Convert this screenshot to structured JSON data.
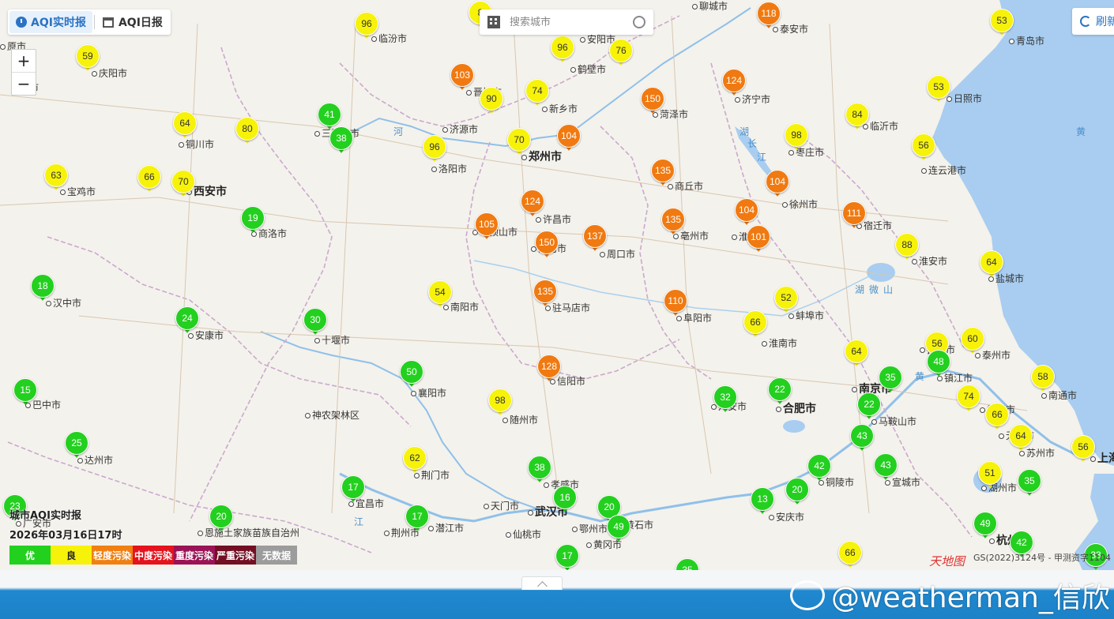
{
  "tabs": [
    {
      "label": "AQI实时报",
      "active": true
    },
    {
      "label": "AQI日报",
      "active": false
    }
  ],
  "zoom": {
    "in": "+",
    "out": "−"
  },
  "search": {
    "placeholder": "搜索城市"
  },
  "refresh_label": "刷新",
  "legend": {
    "title": "城市AQI实时报",
    "time": "2026年03月16日17时",
    "levels": [
      {
        "label": "优",
        "color": "#22d11e"
      },
      {
        "label": "良",
        "color": "#f7f20a"
      },
      {
        "label": "轻度污染",
        "color": "#f08012"
      },
      {
        "label": "中度污染",
        "color": "#e4131d"
      },
      {
        "label": "重度污染",
        "color": "#9b1356"
      },
      {
        "label": "严重污染",
        "color": "#730f24"
      },
      {
        "label": "无数据",
        "color": "#9c9c9c"
      }
    ]
  },
  "copyright": "GS(2022)3124号 - 甲测资字1104",
  "logo_text": "天地图",
  "watermark": "@weatherman_信欣",
  "water_labels": [
    "黄",
    "河",
    "洪",
    "泽",
    "湖",
    "微",
    "山",
    "湖",
    "长",
    "江",
    "江",
    "黄",
    "汉",
    "江"
  ],
  "cities": [
    {
      "name": "原市"
    },
    {
      "name": "临汾市"
    },
    {
      "name": "安阳市"
    },
    {
      "name": "聊城市"
    },
    {
      "name": "泰安市"
    },
    {
      "name": "青岛市"
    },
    {
      "name": "庆阳市"
    },
    {
      "name": "凉市"
    },
    {
      "name": "晋城市"
    },
    {
      "name": "鹤壁市"
    },
    {
      "name": "济宁市"
    },
    {
      "name": "日照市"
    },
    {
      "name": "铜川市"
    },
    {
      "name": "三门峡市"
    },
    {
      "name": "济源市"
    },
    {
      "name": "新乡市"
    },
    {
      "name": "菏泽市"
    },
    {
      "name": "枣庄市"
    },
    {
      "name": "临沂市"
    },
    {
      "name": "宝鸡市"
    },
    {
      "name": "西安市"
    },
    {
      "name": "洛阳市"
    },
    {
      "name": "郑州市"
    },
    {
      "name": "商丘市"
    },
    {
      "name": "连云港市"
    },
    {
      "name": "商洛市"
    },
    {
      "name": "许昌市"
    },
    {
      "name": "平顶山市"
    },
    {
      "name": "漯河市"
    },
    {
      "name": "周口市"
    },
    {
      "name": "亳州市"
    },
    {
      "name": "徐州市"
    },
    {
      "name": "宿迁市"
    },
    {
      "name": "淮北市"
    },
    {
      "name": "淮安市"
    },
    {
      "name": "盐城市"
    },
    {
      "name": "汉中市"
    },
    {
      "name": "南阳市"
    },
    {
      "name": "驻马店市"
    },
    {
      "name": "阜阳市"
    },
    {
      "name": "蚌埠市"
    },
    {
      "name": "安康市"
    },
    {
      "name": "十堰市"
    },
    {
      "name": "淮南市"
    },
    {
      "name": "扬州市"
    },
    {
      "name": "泰州市"
    },
    {
      "name": "信阳市"
    },
    {
      "name": "巴中市"
    },
    {
      "name": "襄阳市"
    },
    {
      "name": "南京市"
    },
    {
      "name": "镇江市"
    },
    {
      "name": "南通市"
    },
    {
      "name": "神农架林区"
    },
    {
      "name": "随州市"
    },
    {
      "name": "六安市"
    },
    {
      "name": "合肥市"
    },
    {
      "name": "马鞍山市"
    },
    {
      "name": "常州市"
    },
    {
      "name": "达州市"
    },
    {
      "name": "无锡市"
    },
    {
      "name": "苏州市"
    },
    {
      "name": "上海市"
    },
    {
      "name": "荆门市"
    },
    {
      "name": "孝感市"
    },
    {
      "name": "铜陵市"
    },
    {
      "name": "宣城市"
    },
    {
      "name": "湖州市"
    },
    {
      "name": "宜昌市"
    },
    {
      "name": "天门市"
    },
    {
      "name": "武汉市"
    },
    {
      "name": "鄂州市"
    },
    {
      "name": "黄冈市"
    },
    {
      "name": "安庆市"
    },
    {
      "name": "广安市"
    },
    {
      "name": "恩施土家族苗族自治州"
    },
    {
      "name": "潜江市"
    },
    {
      "name": "荆州市"
    },
    {
      "name": "仙桃市"
    },
    {
      "name": "黄石市"
    },
    {
      "name": "杭州市"
    }
  ],
  "stations": [
    {
      "aqi": 8,
      "level": "yellow"
    },
    {
      "aqi": 96,
      "level": "yellow"
    },
    {
      "aqi": 118,
      "level": "orange"
    },
    {
      "aqi": 53,
      "level": "yellow"
    },
    {
      "aqi": 59,
      "level": "yellow"
    },
    {
      "aqi": 96,
      "level": "yellow"
    },
    {
      "aqi": 76,
      "level": "yellow"
    },
    {
      "aqi": 103,
      "level": "orange"
    },
    {
      "aqi": 124,
      "level": "orange"
    },
    {
      "aqi": 53,
      "level": "yellow"
    },
    {
      "aqi": 90,
      "level": "yellow"
    },
    {
      "aqi": 74,
      "level": "yellow"
    },
    {
      "aqi": 150,
      "level": "orange"
    },
    {
      "aqi": 41,
      "level": "green"
    },
    {
      "aqi": 64,
      "level": "yellow"
    },
    {
      "aqi": 80,
      "level": "yellow"
    },
    {
      "aqi": 84,
      "level": "yellow"
    },
    {
      "aqi": 98,
      "level": "yellow"
    },
    {
      "aqi": 38,
      "level": "green"
    },
    {
      "aqi": 70,
      "level": "yellow"
    },
    {
      "aqi": 104,
      "level": "orange"
    },
    {
      "aqi": 96,
      "level": "yellow"
    },
    {
      "aqi": 56,
      "level": "yellow"
    },
    {
      "aqi": 63,
      "level": "yellow"
    },
    {
      "aqi": 66,
      "level": "yellow"
    },
    {
      "aqi": 70,
      "level": "yellow"
    },
    {
      "aqi": 135,
      "level": "orange"
    },
    {
      "aqi": 104,
      "level": "orange"
    },
    {
      "aqi": 124,
      "level": "orange"
    },
    {
      "aqi": 19,
      "level": "green"
    },
    {
      "aqi": 105,
      "level": "orange"
    },
    {
      "aqi": 104,
      "level": "orange"
    },
    {
      "aqi": 111,
      "level": "orange"
    },
    {
      "aqi": 150,
      "level": "orange"
    },
    {
      "aqi": 137,
      "level": "orange"
    },
    {
      "aqi": 135,
      "level": "orange"
    },
    {
      "aqi": 101,
      "level": "orange"
    },
    {
      "aqi": 88,
      "level": "yellow"
    },
    {
      "aqi": 64,
      "level": "yellow"
    },
    {
      "aqi": 18,
      "level": "green"
    },
    {
      "aqi": 54,
      "level": "yellow"
    },
    {
      "aqi": 135,
      "level": "orange"
    },
    {
      "aqi": 110,
      "level": "orange"
    },
    {
      "aqi": 52,
      "level": "yellow"
    },
    {
      "aqi": 24,
      "level": "green"
    },
    {
      "aqi": 30,
      "level": "green"
    },
    {
      "aqi": 66,
      "level": "yellow"
    },
    {
      "aqi": 56,
      "level": "yellow"
    },
    {
      "aqi": 60,
      "level": "yellow"
    },
    {
      "aqi": 128,
      "level": "orange"
    },
    {
      "aqi": 64,
      "level": "yellow"
    },
    {
      "aqi": 48,
      "level": "green"
    },
    {
      "aqi": 15,
      "level": "green"
    },
    {
      "aqi": 50,
      "level": "green"
    },
    {
      "aqi": 35,
      "level": "green"
    },
    {
      "aqi": 58,
      "level": "yellow"
    },
    {
      "aqi": 98,
      "level": "yellow"
    },
    {
      "aqi": 32,
      "level": "green"
    },
    {
      "aqi": 22,
      "level": "green"
    },
    {
      "aqi": 74,
      "level": "yellow"
    },
    {
      "aqi": 22,
      "level": "green"
    },
    {
      "aqi": 66,
      "level": "yellow"
    },
    {
      "aqi": 25,
      "level": "green"
    },
    {
      "aqi": 43,
      "level": "green"
    },
    {
      "aqi": 64,
      "level": "yellow"
    },
    {
      "aqi": 56,
      "level": "yellow"
    },
    {
      "aqi": 62,
      "level": "yellow"
    },
    {
      "aqi": 38,
      "level": "green"
    },
    {
      "aqi": 42,
      "level": "green"
    },
    {
      "aqi": 43,
      "level": "green"
    },
    {
      "aqi": 51,
      "level": "yellow"
    },
    {
      "aqi": 35,
      "level": "green"
    },
    {
      "aqi": 17,
      "level": "green"
    },
    {
      "aqi": 16,
      "level": "green"
    },
    {
      "aqi": 20,
      "level": "green"
    },
    {
      "aqi": 13,
      "level": "green"
    },
    {
      "aqi": 20,
      "level": "green"
    },
    {
      "aqi": 23,
      "level": "green"
    },
    {
      "aqi": 20,
      "level": "green"
    },
    {
      "aqi": 49,
      "level": "green"
    },
    {
      "aqi": 17,
      "level": "green"
    },
    {
      "aqi": 49,
      "level": "green"
    },
    {
      "aqi": 42,
      "level": "green"
    },
    {
      "aqi": 17,
      "level": "green"
    },
    {
      "aqi": 66,
      "level": "yellow"
    },
    {
      "aqi": 35,
      "level": "green"
    },
    {
      "aqi": 33,
      "level": "green"
    }
  ]
}
